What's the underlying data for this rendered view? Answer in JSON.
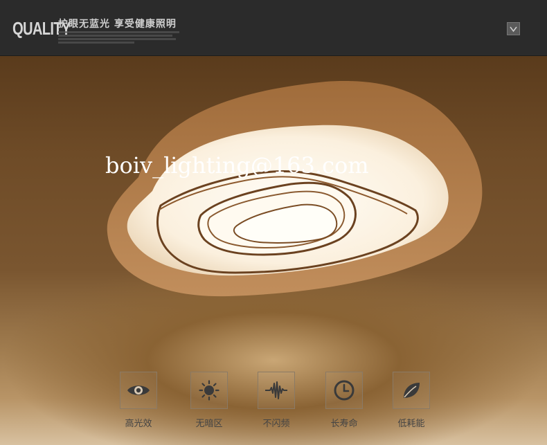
{
  "header": {
    "brand": "QUALITY",
    "headline": "护眼无蓝光 享受健康照明",
    "menu_icon": "chevron-down-icon"
  },
  "banner": {
    "email": "boiv_lighting@163.com"
  },
  "features": [
    {
      "icon": "eye-icon",
      "label": "高光效"
    },
    {
      "icon": "sun-icon",
      "label": "无暗区"
    },
    {
      "icon": "waveform-icon",
      "label": "不闪频"
    },
    {
      "icon": "clock-icon",
      "label": "长寿命"
    },
    {
      "icon": "leaf-icon",
      "label": "低耗能"
    }
  ],
  "colors": {
    "header_bg": "#2b2b2b",
    "lamp_frame": "#b27d4a",
    "lamp_light": "#fff7ea",
    "icon_color": "#3a3a3a"
  }
}
